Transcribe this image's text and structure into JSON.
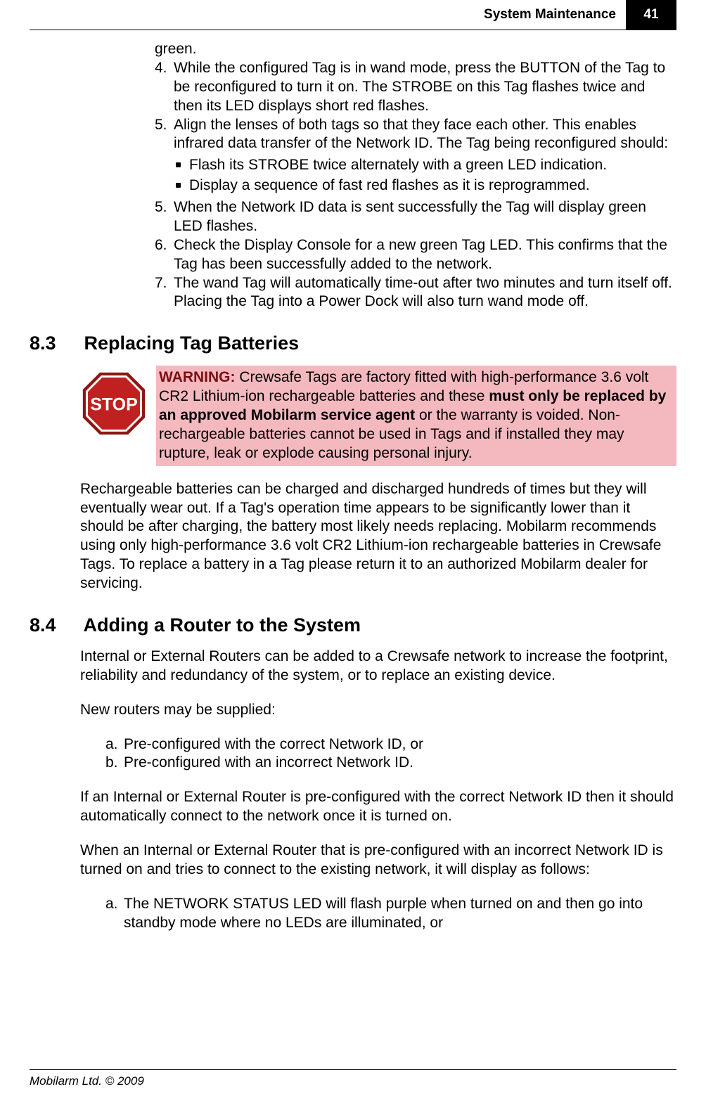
{
  "header": {
    "section_title": "System Maintenance",
    "page_number": "41"
  },
  "continuation": {
    "green_tail": "green.",
    "items": [
      {
        "marker": "4.",
        "text": "While the configured Tag is in wand mode, press the BUTTON of the Tag to be reconfigured to turn it on. The STROBE on this Tag flashes twice and then its LED displays short red flashes."
      },
      {
        "marker": "5.",
        "text": "Align the lenses of both tags so that they face each other. This enables infrared data transfer of the Network ID. The Tag being reconfigured should:"
      },
      {
        "marker": "5.",
        "text": "When the Network ID data is sent successfully the Tag will display green LED flashes."
      },
      {
        "marker": "6.",
        "text": "Check the Display Console for a new green Tag LED. This confirms that the Tag has been successfully added to the network."
      },
      {
        "marker": "7.",
        "text": "The wand Tag will automatically time-out after two minutes and turn itself off. Placing the Tag into a Power Dock will also turn wand mode off."
      }
    ],
    "sub_bullets": [
      "Flash its STROBE twice alternately with a green LED indication.",
      "Display a sequence of fast red flashes as it is reprogrammed."
    ]
  },
  "section_8_3": {
    "number": "8.3",
    "title": "Replacing Tag Batteries",
    "warning_label": "WARNING:",
    "warning_text_1": " Crewsafe Tags are factory fitted with high-performance 3.6 volt CR2 Lithium-ion rechargeable batteries and these ",
    "warning_bold": "must only be replaced by an approved Mobilarm service agent",
    "warning_text_2": " or the warranty is voided. Non-rechargeable batteries cannot be used in Tags and if installed they may rupture, leak or explode causing personal injury.",
    "body": "Rechargeable batteries can be charged and discharged hundreds of times but they will eventually wear out. If a Tag's operation time appears to be significantly lower than it should be after charging, the battery most likely needs replacing. Mobilarm recommends using only high-performance 3.6 volt CR2 Lithium-ion rechargeable batteries in Crewsafe Tags. To replace a battery in a Tag please return it to an authorized Mobilarm dealer for servicing."
  },
  "section_8_4": {
    "number": "8.4",
    "title": "Adding a Router to the System",
    "p1": "Internal or External Routers can be added to a Crewsafe network to increase the footprint, reliability and redundancy of the system, or to replace an existing device.",
    "p2": "New routers may be supplied:",
    "list1": [
      {
        "marker": "a.",
        "text": "Pre-configured with the correct Network ID, or"
      },
      {
        "marker": "b.",
        "text": "Pre-configured with an incorrect Network ID."
      }
    ],
    "p3": "If an Internal or External Router is pre-configured with the correct Network ID then it should automatically connect to the network once it is turned on.",
    "p4": "When an Internal or External Router that is pre-configured with an incorrect Network ID is turned on and tries to connect to the existing network, it will display as follows:",
    "list2": [
      {
        "marker": "a.",
        "text": "The NETWORK STATUS LED will flash purple when turned on and then go into standby mode where no LEDs are illuminated, or"
      }
    ]
  },
  "footer": {
    "copyright": "Mobilarm Ltd. © 2009"
  },
  "icons": {
    "stop": "stop-icon"
  }
}
